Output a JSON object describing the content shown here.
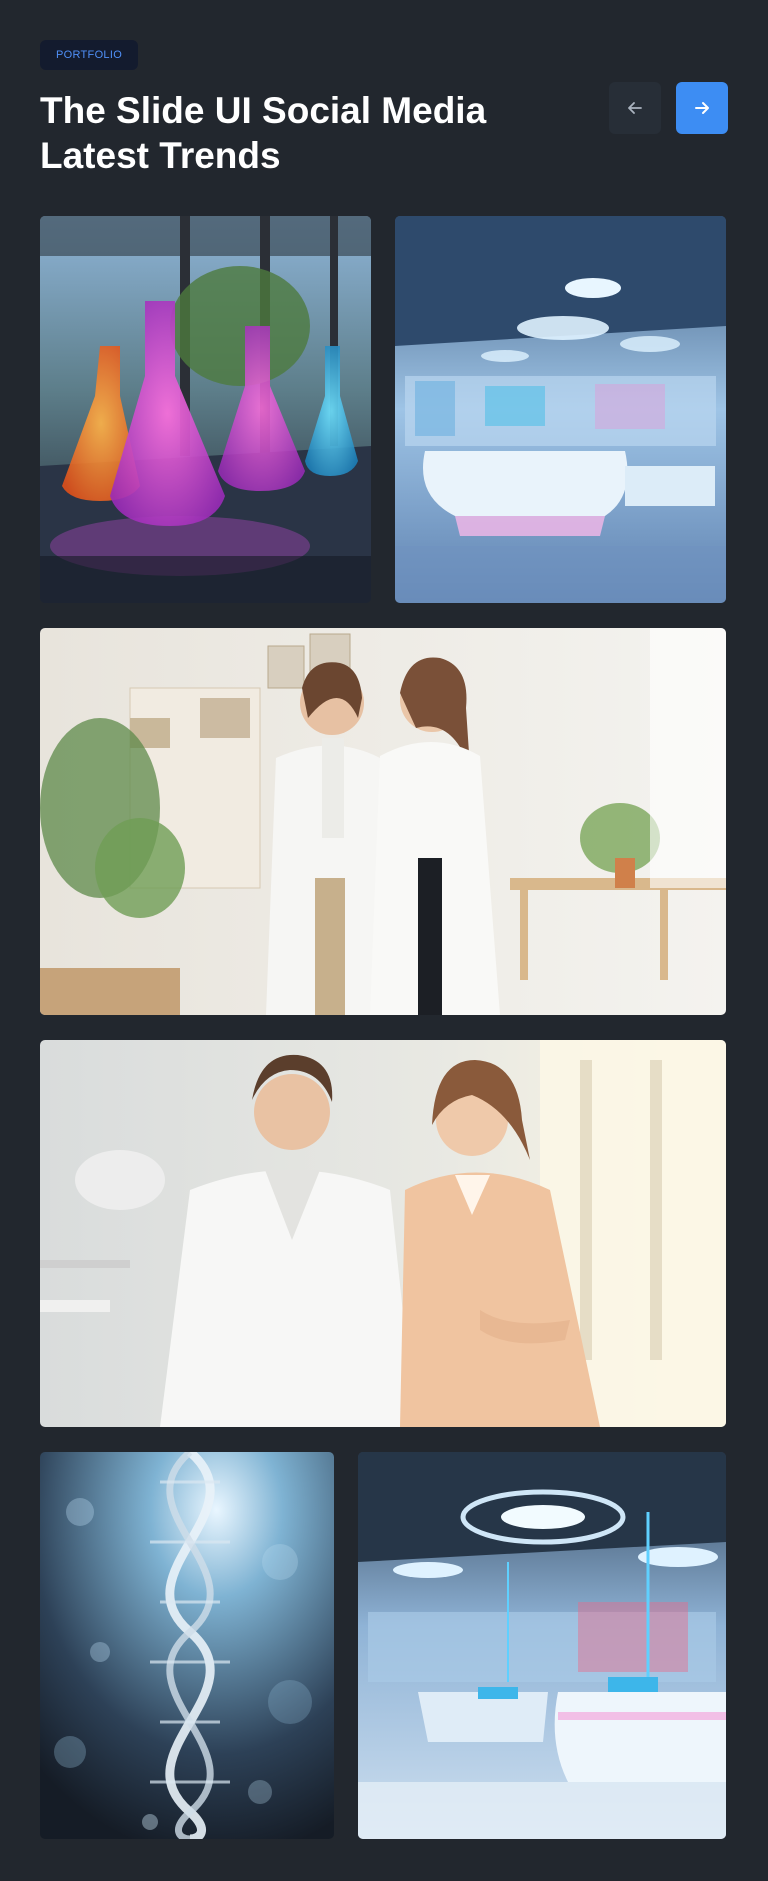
{
  "header": {
    "badge": "PORTFOLIO",
    "title": "The Slide UI Social Media Latest Trends",
    "prev_icon": "arrow-left-icon",
    "next_icon": "arrow-right-icon"
  },
  "gallery": {
    "images": [
      {
        "subject": "colorful-flasks-photo"
      },
      {
        "subject": "futuristic-lab-photo"
      },
      {
        "subject": "two-scientists-lab-photo"
      },
      {
        "subject": "two-smiling-scientists-photo"
      },
      {
        "subject": "dna-helix-photo"
      },
      {
        "subject": "modern-lab-interior-photo"
      }
    ]
  },
  "colors": {
    "background": "#22272e",
    "accent": "#3d8df3",
    "badge_bg": "#131b2e",
    "badge_text": "#4f8ff7"
  }
}
